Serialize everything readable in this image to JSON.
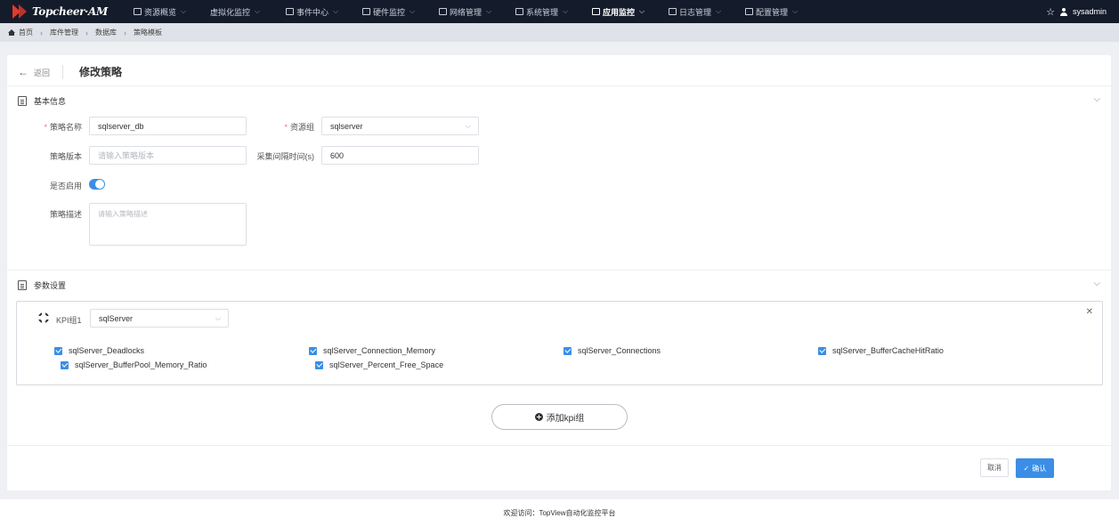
{
  "app": {
    "logo": "Topcheer·AM"
  },
  "nav": [
    {
      "label": "资源概览",
      "icon": "monitor-icon"
    },
    {
      "label": "虚拟化监控",
      "icon": ""
    },
    {
      "label": "事件中心",
      "icon": "event-icon"
    },
    {
      "label": "硬件监控",
      "icon": "hardware-icon"
    },
    {
      "label": "网络管理",
      "icon": "network-icon"
    },
    {
      "label": "系统管理",
      "icon": "system-icon"
    },
    {
      "label": "应用监控",
      "icon": "app-icon",
      "active": true
    },
    {
      "label": "日志管理",
      "icon": "log-icon"
    },
    {
      "label": "配置管理",
      "icon": "config-icon"
    }
  ],
  "user": {
    "name": "sysadmin"
  },
  "breadcrumb": [
    "首页",
    "库件管理",
    "数据库",
    "策略模板"
  ],
  "header": {
    "back": "返回",
    "title": "修改策略"
  },
  "basic": {
    "title": "基本信息",
    "name_label": "策略名称",
    "name_value": "sqlserver_db",
    "group_label": "资源组",
    "group_value": "sqlserver",
    "version_label": "策略版本",
    "version_placeholder": "请输入策略版本",
    "interval_label": "采集间隔时间(s)",
    "interval_value": "600",
    "enable_label": "是否启用",
    "enabled": true,
    "desc_label": "策略描述",
    "desc_placeholder": "请输入策略描述"
  },
  "params": {
    "title": "参数设置",
    "kpi_group_label": "KPI组1",
    "kpi_group_value": "sqlServer",
    "kpis": [
      "sqlServer_Deadlocks",
      "sqlServer_Connection_Memory",
      "sqlServer_Connections",
      "sqlServer_BufferCacheHitRatio",
      "sqlServer_BufferPool_Memory_Ratio",
      "sqlServer_Percent_Free_Space"
    ],
    "add_button": "添加kpi组"
  },
  "actions": {
    "cancel": "取消",
    "confirm": "确认"
  },
  "footer": "欢迎访问：TopView自动化监控平台",
  "colors": {
    "accent": "#3b8ee6",
    "nav_bg": "#141c2b",
    "required": "#f56c6c"
  }
}
